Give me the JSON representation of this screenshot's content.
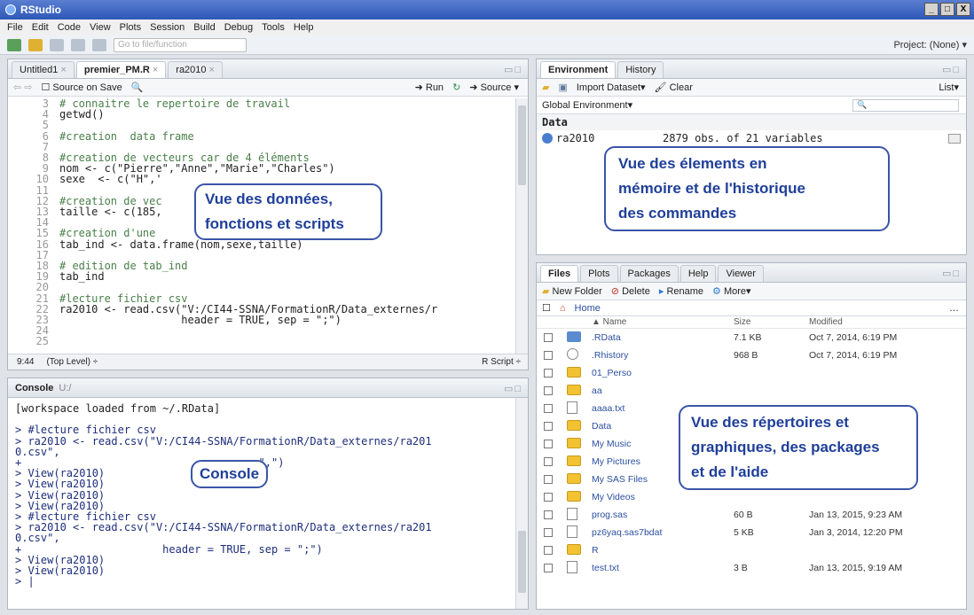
{
  "window": {
    "title": "RStudio",
    "buttons": [
      "_",
      "□",
      "X"
    ]
  },
  "menu": [
    "File",
    "Edit",
    "Code",
    "View",
    "Plots",
    "Session",
    "Build",
    "Debug",
    "Tools",
    "Help"
  ],
  "toolbar": {
    "goto_placeholder": "Go to file/function",
    "project": "Project: (None) ▾"
  },
  "editor": {
    "tabs": [
      {
        "label": "Untitled1",
        "close": "×"
      },
      {
        "label": "premier_PM.R",
        "close": "×"
      },
      {
        "label": "ra2010",
        "close": "×"
      }
    ],
    "source_on_save": "Source on Save",
    "run": "Run",
    "source": "Source",
    "line_numbers": [
      "3",
      "4",
      "5",
      "6",
      "7",
      "8",
      "9",
      "10",
      "11",
      "12",
      "13",
      "14",
      "15",
      "16",
      "17",
      "18",
      "19",
      "20",
      "21",
      "22",
      "23",
      "24",
      "25"
    ],
    "lines": [
      "# connaitre le repertoire de travail",
      "getwd()",
      "",
      "#creation  data frame",
      "",
      "#creation de vecteurs car de 4 éléments",
      "nom <- c(\"Pierre\",\"Anne\",\"Marie\",\"Charles\")",
      "sexe  <- c(\"H\",'",
      "",
      "#creation de vec",
      "taille <- c(185,",
      "",
      "#creation d'une",
      "tab_ind <- data.frame(nom,sexe,taille)",
      "",
      "# edition de tab_ind",
      "tab_ind",
      "",
      "#lecture fichier csv",
      "ra2010 <- read.csv(\"V:/CI44-SSNA/FormationR/Data_externes/r",
      "                   header = TRUE, sep = \";\")",
      "",
      ""
    ],
    "cursor_pos": "9:44",
    "scope": "(Top Level) ÷",
    "file_type": "R Script ÷",
    "callout": [
      "Vue des données,",
      "fonctions et scripts"
    ]
  },
  "console": {
    "title": "Console",
    "path": "U:/",
    "lines": [
      "[workspace loaded from ~/.RData]",
      "",
      "> #lecture fichier csv",
      "> ra2010 <- read.csv(\"V:/CI44-SSNA/FormationR/Data_externes/ra201",
      "0.csv\",",
      "+                               sep = \",\")",
      "> View(ra2010)",
      "> View(ra2010)",
      "> View(ra2010)",
      "> View(ra2010)",
      "> #lecture fichier csv",
      "> ra2010 <- read.csv(\"V:/CI44-SSNA/FormationR/Data_externes/ra201",
      "0.csv\",",
      "+                      header = TRUE, sep = \";\")",
      "> View(ra2010)",
      "> View(ra2010)",
      "> |"
    ],
    "callout": "Console"
  },
  "environment": {
    "tabs": [
      "Environment",
      "History"
    ],
    "import": "Import Dataset▾",
    "clear": "Clear",
    "list": "List▾",
    "scope": "Global Environment▾",
    "section": "Data",
    "row_name": "ra2010",
    "row_value": "2879 obs. of 21 variables",
    "callout": [
      "Vue des élements en",
      "mémoire et de l'historique",
      "des commandes"
    ]
  },
  "files": {
    "tabs": [
      "Files",
      "Plots",
      "Packages",
      "Help",
      "Viewer"
    ],
    "new_folder": "New Folder",
    "delete": "Delete",
    "rename": "Rename",
    "more": "More▾",
    "breadcrumb": "Home",
    "headers": {
      "name": "▲ Name",
      "size": "Size",
      "modified": "Modified"
    },
    "rows": [
      {
        "name": ".RData",
        "size": "7.1 KB",
        "modified": "Oct 7, 2014, 6:19 PM",
        "icon": "rdata"
      },
      {
        "name": ".Rhistory",
        "size": "968 B",
        "modified": "Oct 7, 2014, 6:19 PM",
        "icon": "rhist"
      },
      {
        "name": "01_Perso",
        "size": "",
        "modified": "",
        "icon": "folder"
      },
      {
        "name": "aa",
        "size": "",
        "modified": "",
        "icon": "folder"
      },
      {
        "name": "aaaa.txt",
        "size": "",
        "modified": "",
        "icon": "doc"
      },
      {
        "name": "Data",
        "size": "",
        "modified": "",
        "icon": "folder"
      },
      {
        "name": "My Music",
        "size": "",
        "modified": "",
        "icon": "folder"
      },
      {
        "name": "My Pictures",
        "size": "",
        "modified": "",
        "icon": "folder"
      },
      {
        "name": "My SAS Files",
        "size": "",
        "modified": "",
        "icon": "folder"
      },
      {
        "name": "My Videos",
        "size": "",
        "modified": "",
        "icon": "folder"
      },
      {
        "name": "prog.sas",
        "size": "60 B",
        "modified": "Jan 13, 2015, 9:23 AM",
        "icon": "doc"
      },
      {
        "name": "pz6yaq.sas7bdat",
        "size": "5 KB",
        "modified": "Jan 3, 2014, 12:20 PM",
        "icon": "doc"
      },
      {
        "name": "R",
        "size": "",
        "modified": "",
        "icon": "folder"
      },
      {
        "name": "test.txt",
        "size": "3 B",
        "modified": "Jan 13, 2015, 9:19 AM",
        "icon": "doc"
      }
    ],
    "callout": [
      "Vue des répertoires et",
      "graphiques, des packages",
      "et de l'aide"
    ]
  }
}
